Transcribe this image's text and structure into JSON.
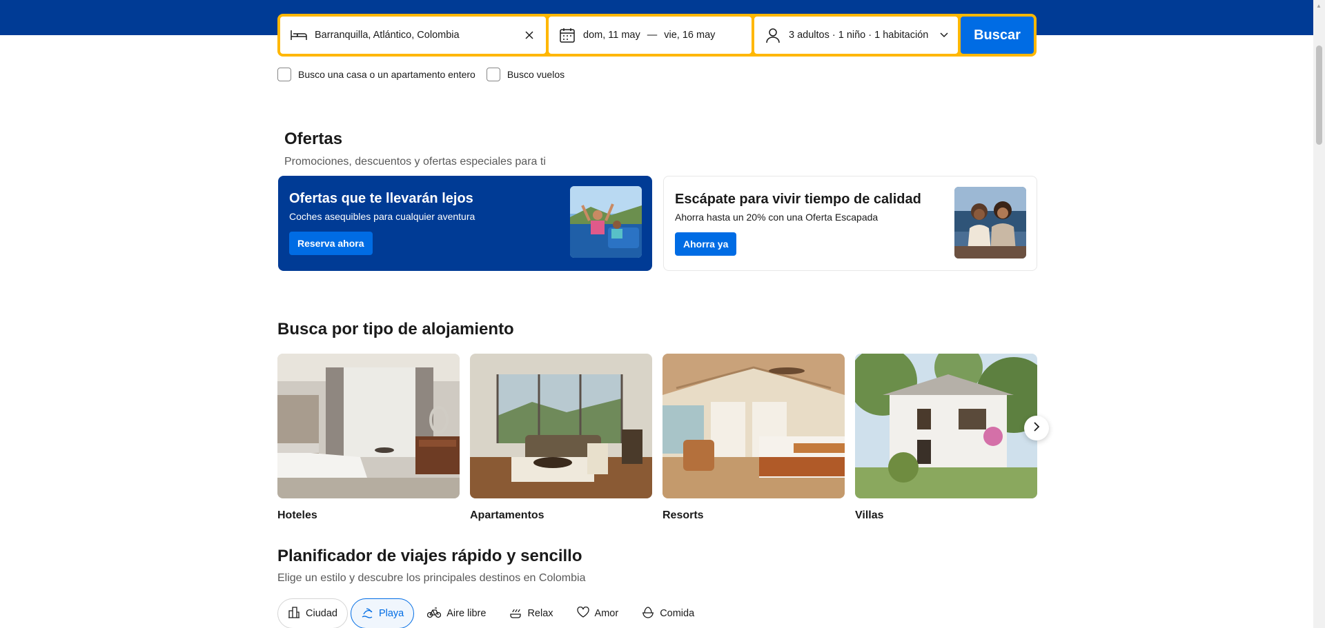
{
  "search": {
    "destination": "Barranquilla, Atlántico, Colombia",
    "checkin": "dom, 11 may",
    "date_separator": "—",
    "checkout": "vie, 16 may",
    "guests": "3 adultos · 1 niño · 1 habitación",
    "button": "Buscar"
  },
  "options": {
    "house": "Busco una casa o un apartamento entero",
    "flights": "Busco vuelos"
  },
  "offers": {
    "title": "Ofertas",
    "subtitle": "Promociones, descuentos y ofertas especiales para ti",
    "cards": [
      {
        "title": "Ofertas que te llevarán lejos",
        "text": "Coches asequibles para cualquier aventura",
        "button": "Reserva ahora"
      },
      {
        "title": "Escápate para vivir tiempo de calidad",
        "text": "Ahorra hasta un 20% con una Oferta Escapada",
        "button": "Ahorra ya"
      }
    ]
  },
  "property_types": {
    "title": "Busca por tipo de alojamiento",
    "items": [
      {
        "label": "Hoteles"
      },
      {
        "label": "Apartamentos"
      },
      {
        "label": "Resorts"
      },
      {
        "label": "Villas"
      }
    ]
  },
  "planner": {
    "title": "Planificador de viajes rápido y sencillo",
    "subtitle": "Elige un estilo y descubre los principales destinos en Colombia",
    "chips": [
      {
        "label": "Ciudad",
        "icon": "city-icon"
      },
      {
        "label": "Playa",
        "icon": "beach-icon",
        "selected": true
      },
      {
        "label": "Aire libre",
        "icon": "bike-icon"
      },
      {
        "label": "Relax",
        "icon": "relax-icon"
      },
      {
        "label": "Amor",
        "icon": "heart-icon"
      },
      {
        "label": "Comida",
        "icon": "food-icon"
      }
    ]
  },
  "colors": {
    "brand_blue": "#003b95",
    "action_blue": "#006ce4",
    "search_border": "#ffb700"
  }
}
